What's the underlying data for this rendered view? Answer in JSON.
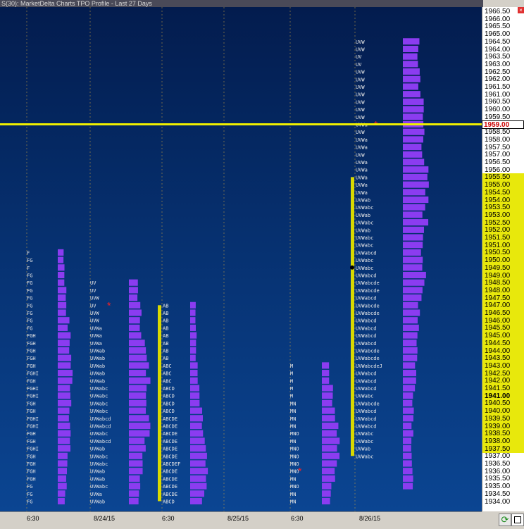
{
  "window": {
    "title": "S(30): MarketDelta Charts TPO Profile - Last 27 Days"
  },
  "price_axis": {
    "ticks": [
      "1966.50",
      "1966.00",
      "1965.50",
      "1965.00",
      "1964.50",
      "1964.00",
      "1963.50",
      "1963.00",
      "1962.50",
      "1962.00",
      "1961.50",
      "1961.00",
      "1960.50",
      "1960.00",
      "1959.50",
      "1959.00",
      "1958.50",
      "1958.00",
      "1957.50",
      "1957.00",
      "1956.50",
      "1956.00",
      "1955.50",
      "1955.00",
      "1954.50",
      "1954.00",
      "1953.50",
      "1953.00",
      "1952.50",
      "1952.00",
      "1951.50",
      "1951.00",
      "1950.50",
      "1950.00",
      "1949.50",
      "1949.00",
      "1948.50",
      "1948.00",
      "1947.50",
      "1947.00",
      "1946.50",
      "1946.00",
      "1945.50",
      "1945.00",
      "1944.50",
      "1944.00",
      "1943.50",
      "1943.00",
      "1942.50",
      "1942.00",
      "1941.50",
      "1941.00",
      "1940.50",
      "1940.00",
      "1939.50",
      "1939.00",
      "1938.50",
      "1938.00",
      "1937.50",
      "1937.00",
      "1936.50",
      "1936.00",
      "1935.50",
      "1935.00",
      "1934.50",
      "1934.00"
    ],
    "current_price": "1959.00",
    "value_area_high": "1955.50",
    "value_area_low": "1937.50",
    "marked_price": "1941.00"
  },
  "time_axis": {
    "labels": [
      "6:30",
      "8/24/15",
      "6:30",
      "8/25/15",
      "6:30",
      "8/26/15"
    ]
  },
  "colors": {
    "background_top": "#031c4e",
    "background_bottom": "#0b4592",
    "histogram": "#8b3cf0",
    "value_area_bar": "#d9d900",
    "price_line": "#f0f000",
    "poc_marker": "#ff2020",
    "letters": "#e8e8e8"
  },
  "icons": {
    "close": "close-icon",
    "refresh": "refresh-icon",
    "window": "window-icon"
  },
  "ui": {
    "close_glyph": "×",
    "refresh_glyph": "⟳"
  }
}
